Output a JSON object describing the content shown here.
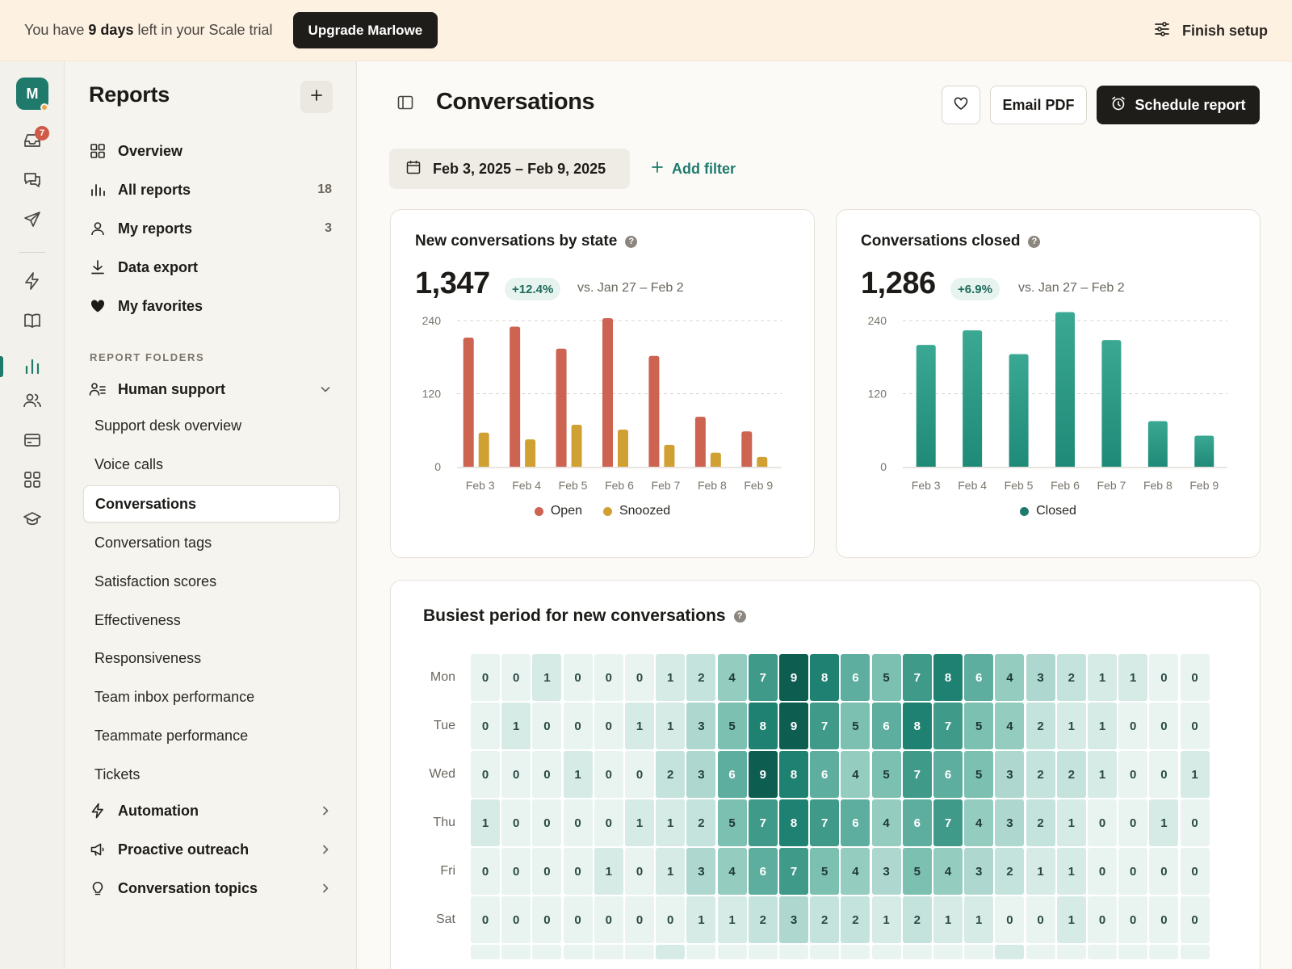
{
  "banner": {
    "trial_prefix": "You have ",
    "trial_bold": "9 days",
    "trial_suffix": " left in your Scale trial",
    "upgrade_label": "Upgrade Marlowe",
    "finish_label": "Finish setup"
  },
  "rail": {
    "avatar_letter": "M",
    "inbox_badge": "7",
    "icons": [
      "inbox-icon",
      "chat-icon",
      "send-icon",
      "bolt-icon",
      "book-icon",
      "bar-chart-icon",
      "people-icon",
      "card-icon",
      "apps-icon",
      "graduation-icon"
    ]
  },
  "sidebar": {
    "title": "Reports",
    "items": [
      {
        "label": "Overview",
        "icon": "grid-icon",
        "count": ""
      },
      {
        "label": "All reports",
        "icon": "bar-chart-icon",
        "count": "18"
      },
      {
        "label": "My reports",
        "icon": "user-icon",
        "count": "3"
      },
      {
        "label": "Data export",
        "icon": "download-icon",
        "count": ""
      },
      {
        "label": "My favorites",
        "icon": "heart-icon",
        "count": ""
      }
    ],
    "folders_heading": "REPORT FOLDERS",
    "human_support": "Human support",
    "subitems": [
      "Support desk overview",
      "Voice calls",
      "Conversations",
      "Conversation tags",
      "Satisfaction scores",
      "Effectiveness",
      "Responsiveness",
      "Team inbox performance",
      "Teammate performance",
      "Tickets"
    ],
    "active_subitem": "Conversations",
    "groups": [
      "Automation",
      "Proactive outreach",
      "Conversation topics"
    ]
  },
  "main": {
    "title": "Conversations",
    "email_label": "Email PDF",
    "schedule_label": "Schedule report",
    "date_range": "Feb 3, 2025 – Feb 9, 2025",
    "add_filter": "Add filter"
  },
  "cards": {
    "by_state": {
      "title": "New conversations by state",
      "total": "1,347",
      "delta": "+12.4%",
      "vs": "vs. Jan 27 – Feb 2"
    },
    "closed": {
      "title": "Conversations closed",
      "total": "1,286",
      "delta": "+6.9%",
      "vs": "vs. Jan 27 – Feb 2"
    },
    "heatmap": {
      "title": "Busiest period for new conversations"
    }
  },
  "colors": {
    "open": "#cd6351",
    "snoozed": "#d1a033",
    "closed": "#2a9b87",
    "accent": "#1f7a6c"
  },
  "chart_data": [
    {
      "type": "bar",
      "categories": [
        "Feb 3",
        "Feb 4",
        "Feb 5",
        "Feb 6",
        "Feb 7",
        "Feb 8",
        "Feb 9"
      ],
      "series": [
        {
          "name": "Open",
          "values": [
            212,
            230,
            194,
            244,
            182,
            82,
            58
          ]
        },
        {
          "name": "Snoozed",
          "values": [
            56,
            45,
            69,
            61,
            36,
            23,
            16
          ]
        }
      ],
      "ylim": [
        0,
        240
      ],
      "yticks": [
        0,
        120,
        240
      ],
      "grid": true,
      "legend": "bottom"
    },
    {
      "type": "bar",
      "categories": [
        "Feb 3",
        "Feb 4",
        "Feb 5",
        "Feb 6",
        "Feb 7",
        "Feb 8",
        "Feb 9"
      ],
      "series": [
        {
          "name": "Closed",
          "values": [
            200,
            224,
            185,
            254,
            208,
            75,
            51
          ]
        }
      ],
      "ylim": [
        0,
        240
      ],
      "yticks": [
        0,
        120,
        240
      ],
      "grid": true,
      "legend": "bottom"
    },
    {
      "type": "heatmap",
      "rows": [
        "Mon",
        "Tue",
        "Wed",
        "Thu",
        "Fri",
        "Sat"
      ],
      "values": [
        [
          0,
          0,
          1,
          0,
          0,
          0,
          1,
          2,
          4,
          7,
          9,
          8,
          6,
          5,
          7,
          8,
          6,
          4,
          3,
          2,
          1,
          1,
          0,
          0
        ],
        [
          0,
          1,
          0,
          0,
          0,
          1,
          1,
          3,
          5,
          8,
          9,
          7,
          5,
          6,
          8,
          7,
          5,
          4,
          2,
          1,
          1,
          0,
          0,
          0
        ],
        [
          0,
          0,
          0,
          1,
          0,
          0,
          2,
          3,
          6,
          9,
          8,
          6,
          4,
          5,
          7,
          6,
          5,
          3,
          2,
          2,
          1,
          0,
          0,
          1
        ],
        [
          1,
          0,
          0,
          0,
          0,
          1,
          1,
          2,
          5,
          7,
          8,
          7,
          6,
          4,
          6,
          7,
          4,
          3,
          2,
          1,
          0,
          0,
          1,
          0
        ],
        [
          0,
          0,
          0,
          0,
          1,
          0,
          1,
          3,
          4,
          6,
          7,
          5,
          4,
          3,
          5,
          4,
          3,
          2,
          1,
          1,
          0,
          0,
          0,
          0
        ],
        [
          0,
          0,
          0,
          0,
          0,
          0,
          0,
          1,
          1,
          2,
          3,
          2,
          2,
          1,
          2,
          1,
          1,
          0,
          0,
          1,
          0,
          0,
          0,
          0
        ]
      ]
    }
  ]
}
